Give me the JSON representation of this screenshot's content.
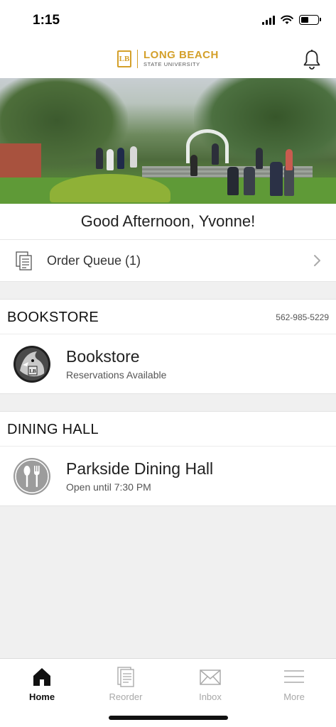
{
  "status_bar": {
    "time": "1:15"
  },
  "header": {
    "logo_mark": "LB",
    "logo_main": "LONG BEACH",
    "logo_sub": "STATE UNIVERSITY",
    "icon": "bell-icon"
  },
  "greeting": "Good Afternoon, Yvonne!",
  "order_queue": {
    "label": "Order Queue (1)",
    "icon": "receipt-stack-icon"
  },
  "sections": [
    {
      "title": "BOOKSTORE",
      "phone": "562-985-5229",
      "venue": {
        "name": "Bookstore",
        "subtitle": "Reservations Available",
        "icon": "shark-mascot-icon"
      }
    },
    {
      "title": "DINING HALL",
      "venue": {
        "name": "Parkside Dining Hall",
        "subtitle": "Open until 7:30 PM",
        "icon": "fork-spoon-icon"
      }
    }
  ],
  "tabs": [
    {
      "label": "Home",
      "icon": "home-icon",
      "active": true
    },
    {
      "label": "Reorder",
      "icon": "receipt-icon",
      "active": false
    },
    {
      "label": "Inbox",
      "icon": "envelope-icon",
      "active": false
    },
    {
      "label": "More",
      "icon": "menu-icon",
      "active": false
    }
  ],
  "colors": {
    "brand_gold": "#d4a02a",
    "active_tab": "#111111",
    "inactive_tab": "#a8a8a8"
  }
}
